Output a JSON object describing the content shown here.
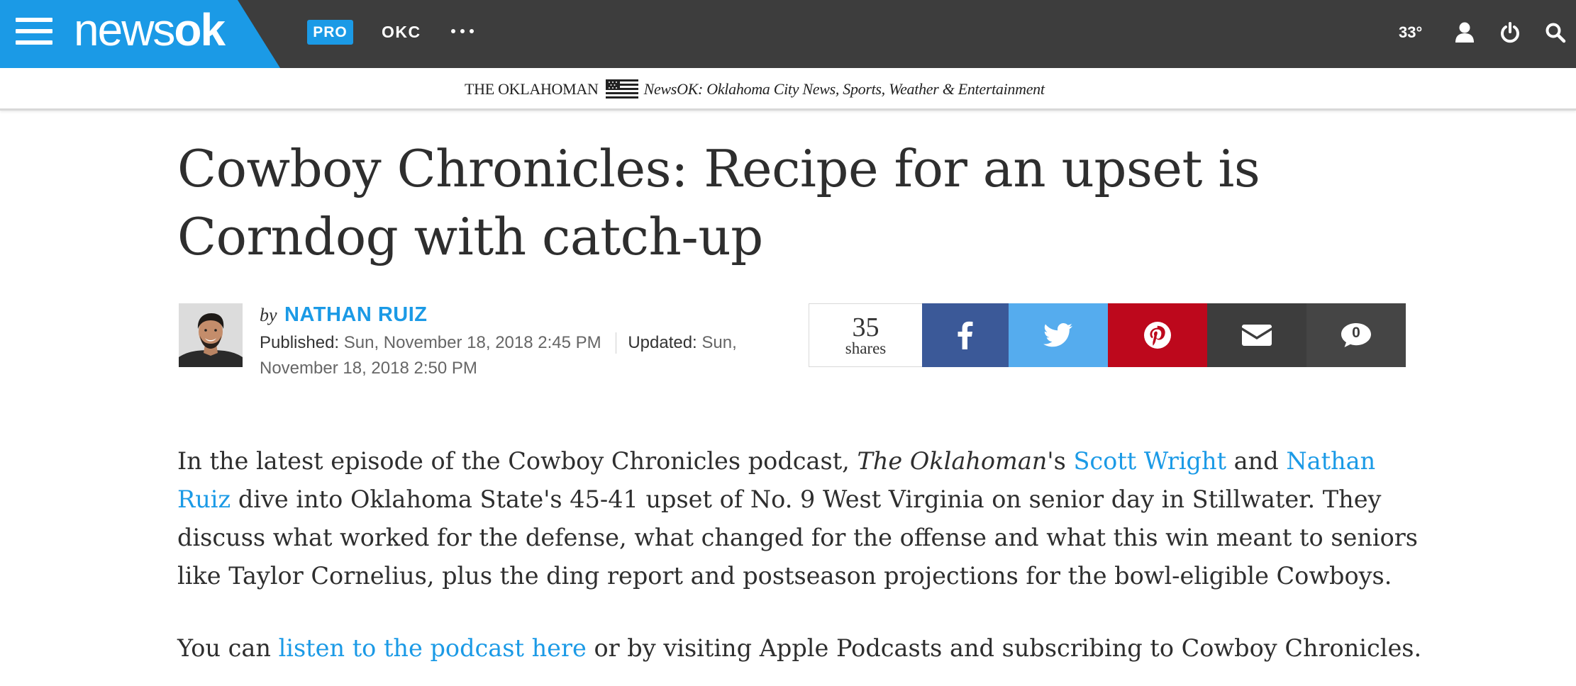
{
  "header": {
    "logo_light": "news",
    "logo_bold": "ok",
    "pro_label": "PRO",
    "nav_okc": "OKC",
    "temperature": "33°",
    "brand_color": "#1b9ae6",
    "bar_color": "#3d3d3d",
    "icons": [
      "hamburger-menu-icon",
      "more-dots-icon",
      "user-icon",
      "power-icon",
      "search-icon"
    ]
  },
  "tagline": {
    "paper": "THE OKLAHOMAN",
    "description": "NewsOK: Oklahoma City News, Sports, Weather & Entertainment"
  },
  "article": {
    "headline": "Cowboy Chronicles: Recipe for an upset is Corndog with catch-up",
    "byline_prefix": "by",
    "author": "NATHAN RUIZ",
    "published_label": "Published:",
    "published_value": "Sun, November 18, 2018 2:45 PM",
    "updated_label": "Updated:",
    "updated_value": "Sun, November 18, 2018 2:50 PM",
    "body": {
      "p1_a": "In the latest episode of the Cowboy Chronicles podcast, ",
      "p1_em": "The Oklahoman",
      "p1_b": "'s ",
      "p1_link1": "Scott Wright",
      "p1_c": " and ",
      "p1_link2": "Nathan Ruiz",
      "p1_d": " dive into Oklahoma State's 45-41 upset of No. 9 West Virginia on senior day in Stillwater. They discuss what worked for the defense, what changed for the offense and what this win meant to seniors like Taylor Cornelius, plus the ding report and postseason projections for the bowl-eligible Cowboys.",
      "p2_a": "You can ",
      "p2_link": "listen to the podcast here",
      "p2_b": " or by visiting Apple Podcasts and subscribing to Cowboy Chronicles."
    }
  },
  "share": {
    "count": "35",
    "count_label": "shares",
    "buttons": [
      {
        "name": "facebook",
        "icon": "facebook-icon",
        "color": "#3b5998"
      },
      {
        "name": "twitter",
        "icon": "twitter-icon",
        "color": "#55acee"
      },
      {
        "name": "pinterest",
        "icon": "pinterest-icon",
        "color": "#bd081c"
      },
      {
        "name": "email",
        "icon": "email-icon",
        "color": "#3d3d3d"
      },
      {
        "name": "comments",
        "icon": "comment-icon",
        "color": "#454545",
        "count": "0"
      }
    ]
  }
}
